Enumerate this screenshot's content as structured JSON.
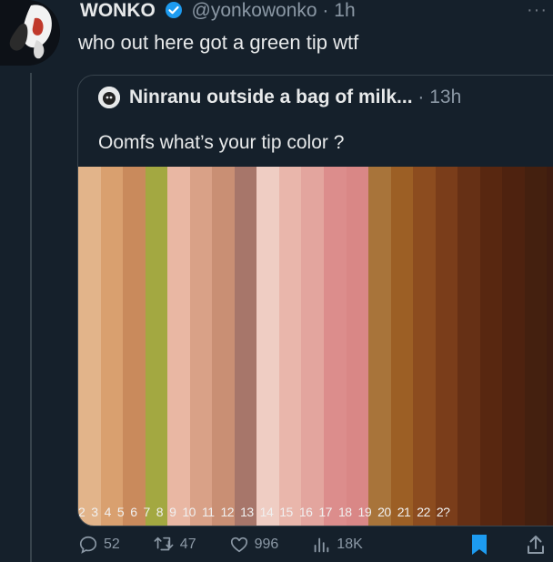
{
  "tweet": {
    "author_name": "WONKO",
    "handle": "@yonkowonko",
    "separator": "·",
    "time": "1h",
    "text": "who out here got a green tip wtf",
    "more_label": "···"
  },
  "quote": {
    "author_name": "Ninranu outside a bag of milk...",
    "separator": "·",
    "time": "13h",
    "text": "Oomfs what’s your tip color ?",
    "swatch_colors": [
      "#e2b48a",
      "#d9a06f",
      "#c98a5c",
      "#a3a841",
      "#e9b7a3",
      "#d9a187",
      "#c98f74",
      "#a7766a",
      "#efcdc3",
      "#e9b6ab",
      "#e3a59e",
      "#dc8d8c",
      "#d98786",
      "#a8743a",
      "#9c5f25",
      "#8c4c1f",
      "#7a3d1a",
      "#663015",
      "#582710",
      "#4e220f",
      "#44200f",
      "#3f1c10"
    ],
    "numbers": [
      "2",
      "3",
      "4",
      "5",
      "6",
      "7",
      "8",
      "9",
      "10",
      "11",
      "12",
      "13",
      "14",
      "15",
      "16",
      "17",
      "18",
      "19",
      "20",
      "21",
      "22",
      "2?"
    ]
  },
  "actions": {
    "reply_count": "52",
    "retweet_count": "47",
    "like_count": "996",
    "views_count": "18K"
  },
  "colors": {
    "background": "#15202b",
    "accent": "#1d9bf0",
    "muted": "#8b98a5"
  }
}
